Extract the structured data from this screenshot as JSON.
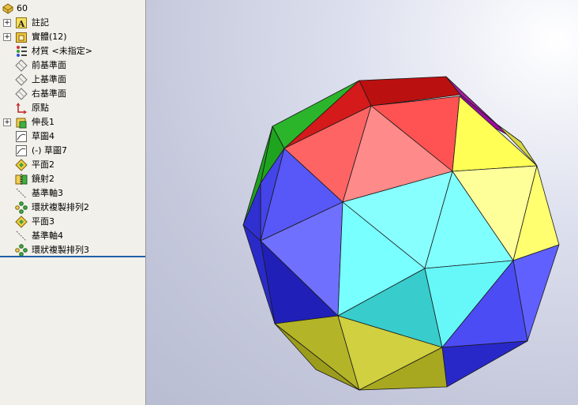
{
  "tree": {
    "root": {
      "label": "60",
      "icon": "part-icon"
    },
    "items": [
      {
        "label": "註記",
        "icon": "annotation-icon",
        "expandable": true
      },
      {
        "label": "實體(12)",
        "icon": "solid-bodies-icon",
        "expandable": true
      },
      {
        "label": "材質 <未指定>",
        "icon": "material-icon",
        "expandable": false
      },
      {
        "label": "前基準面",
        "icon": "plane-icon",
        "expandable": false
      },
      {
        "label": "上基準面",
        "icon": "plane-icon",
        "expandable": false
      },
      {
        "label": "右基準面",
        "icon": "plane-icon",
        "expandable": false
      },
      {
        "label": "原點",
        "icon": "origin-icon",
        "expandable": false
      },
      {
        "label": "伸長1",
        "icon": "extrude-icon",
        "expandable": true
      },
      {
        "label": "草圖4",
        "icon": "sketch-icon",
        "expandable": false
      },
      {
        "label": "(-) 草圖7",
        "icon": "sketch-icon",
        "expandable": false
      },
      {
        "label": "平面2",
        "icon": "ref-plane-icon",
        "expandable": false
      },
      {
        "label": "鏡射2",
        "icon": "mirror-icon",
        "expandable": false
      },
      {
        "label": "基準軸3",
        "icon": "axis-icon",
        "expandable": false
      },
      {
        "label": "環狀複製排列2",
        "icon": "circular-pattern-icon",
        "expandable": false
      },
      {
        "label": "平面3",
        "icon": "ref-plane-icon",
        "expandable": false
      },
      {
        "label": "基準軸4",
        "icon": "axis-icon",
        "expandable": false
      },
      {
        "label": "環狀複製排列3",
        "icon": "circular-pattern-icon",
        "expandable": false
      }
    ]
  },
  "viewport": {
    "colors": {
      "green": "#2bb52b",
      "red": "#ff5a5a",
      "purple": "#a020a0",
      "yellow": "#ffff66",
      "blue": "#5a5aff",
      "cyan": "#80ffff",
      "olive": "#c8c850",
      "edge": "#1a1a1a"
    }
  }
}
